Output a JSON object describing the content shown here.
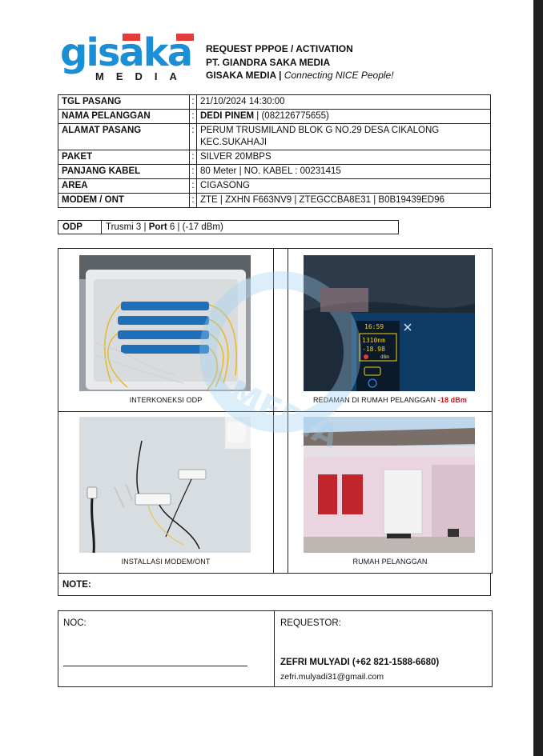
{
  "brand": {
    "logo_word": "gisaka",
    "logo_sub": "M E D I A",
    "title_line1": "REQUEST PPPOE / ACTIVATION",
    "title_line2": "PT. GIANDRA SAKA MEDIA",
    "title_line3_company": "GISAKA MEDIA",
    "title_line3_sep": " | ",
    "title_line3_tagline": "Connecting NICE People!",
    "colors": {
      "blue": "#1a8fd6",
      "red": "#e33a3a",
      "dark": "#1b1b1b"
    }
  },
  "info": [
    {
      "label": "TGL PASANG",
      "value": "21/10/2024 14:30:00"
    },
    {
      "label": "NAMA PELANGGAN",
      "value_bold": "DEDI PINEM",
      "value": " | (082126775655)"
    },
    {
      "label": "ALAMAT PASANG",
      "value": "PERUM TRUSMILAND BLOK G NO.29 DESA CIKALONG KEC.SUKAHAJI"
    },
    {
      "label": "PAKET",
      "value": "SILVER 20MBPS"
    },
    {
      "label": "PANJANG KABEL",
      "value": "80  Meter  | NO. KABEL : 00231415"
    },
    {
      "label": "AREA",
      "value": "CIGASONG"
    },
    {
      "label": "MODEM / ONT",
      "value": "ZTE |  ZXHN F663NV9 | ZTEGCCBA8E31 |  B0B19439ED96"
    }
  ],
  "colon": ":",
  "odp": {
    "label": "ODP",
    "name": "Trusmi 3 | ",
    "port_label": "Port",
    "port_value": " 6 |  (-17 dBm)"
  },
  "photos": {
    "p1_caption": "INTERKONEKSI ODP",
    "p2_caption": "REDAMAN DI RUMAH PELANGGAN ",
    "p2_caption_value": "-18 dBm",
    "p3_caption": "INSTALLASI MODEM/ONT",
    "p4_caption": "RUMAH PELANGGAN",
    "meter_time": "16:59",
    "meter_wave": "1310nm",
    "meter_power": "-18.98",
    "meter_unit": "dBm"
  },
  "note_label": "NOTE:",
  "sign": {
    "noc_label": "NOC:",
    "requestor_label": "REQUESTOR:",
    "requestor_name": "ZEFRI MULYADI (+62 821-1588-6680)",
    "requestor_email": "zefri.mulyadi31@gmail.com"
  }
}
